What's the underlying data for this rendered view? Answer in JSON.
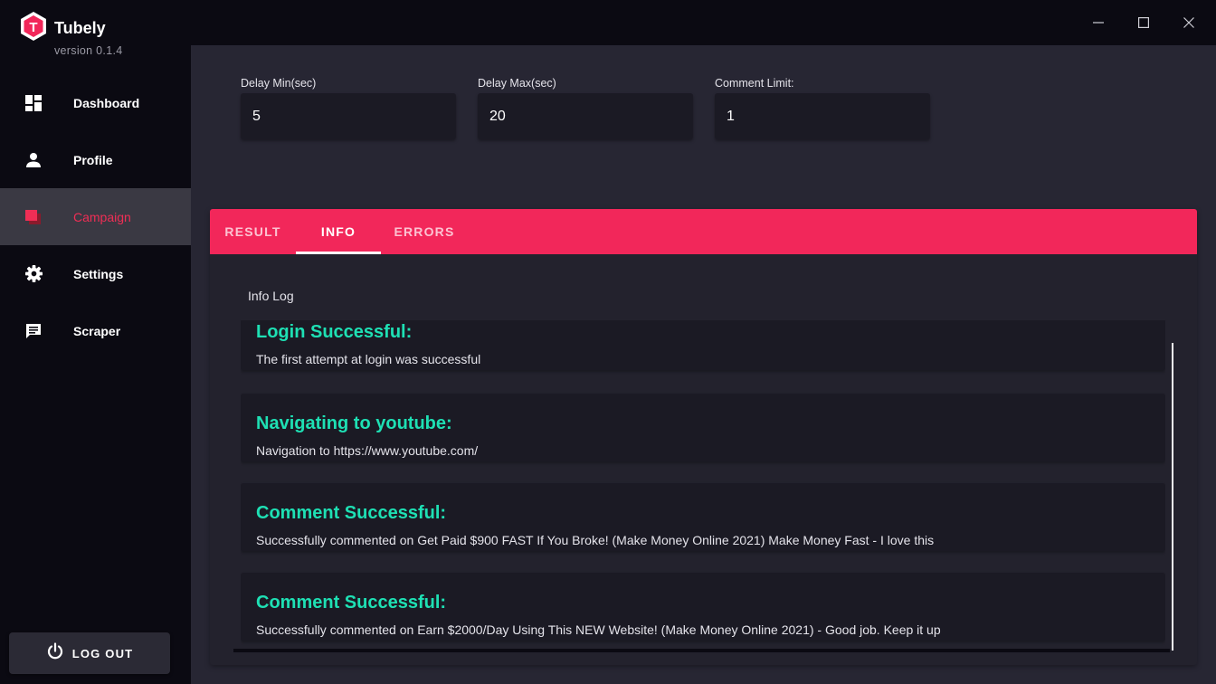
{
  "app": {
    "name": "Tubely",
    "version": "version 0.1.4",
    "logo_letter": "T",
    "accent_color": "#f2275a",
    "success_color": "#1ee0b4"
  },
  "sidebar": {
    "items": [
      {
        "label": "Dashboard",
        "icon": "dashboard-icon",
        "active": false
      },
      {
        "label": "Profile",
        "icon": "person-icon",
        "active": false
      },
      {
        "label": "Campaign",
        "icon": "campaign-icon",
        "active": true
      },
      {
        "label": "Settings",
        "icon": "gear-icon",
        "active": false
      },
      {
        "label": "Scraper",
        "icon": "chat-icon",
        "active": false
      }
    ],
    "logout_label": "LOG OUT"
  },
  "window_controls": [
    "minimize-icon",
    "maximize-icon",
    "close-icon"
  ],
  "campaign": {
    "delay_min": {
      "label": "Delay Min(sec)",
      "value": "5"
    },
    "delay_max": {
      "label": "Delay Max(sec)",
      "value": "20"
    },
    "comment_limit": {
      "label": "Comment Limit:",
      "value": "1"
    }
  },
  "tabs": [
    {
      "label": "RESULT",
      "active": false
    },
    {
      "label": "INFO",
      "active": true
    },
    {
      "label": "ERRORS",
      "active": false
    }
  ],
  "info_log": {
    "title": "Info Log",
    "entries": [
      {
        "title": "Login Successful:",
        "message": "The first attempt at login was successful"
      },
      {
        "title": "Navigating to youtube:",
        "message": "Navigation to https://www.youtube.com/"
      },
      {
        "title": "Comment Successful:",
        "message": "Successfully commented on Get Paid $900 FAST If You Broke! (Make Money Online 2021) Make Money Fast - I love this"
      },
      {
        "title": "Comment Successful:",
        "message": "Successfully commented on Earn $2000/Day Using This NEW Website! (Make Money Online 2021) - Good job. Keep it up"
      }
    ]
  }
}
